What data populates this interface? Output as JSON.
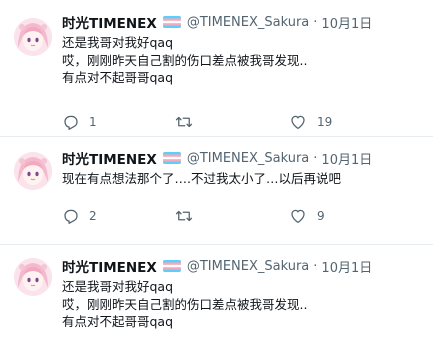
{
  "tweets": [
    {
      "display_name": "时光TIMENEX",
      "handle": "@TIMENEX_Sakura",
      "separator": "·",
      "date": "10月1日",
      "lines": [
        "还是我哥对我好qaq",
        "哎，刚刚昨天自己割的伤口差点被我哥发现..",
        "有点对不起哥哥qaq"
      ],
      "reply_count": "1",
      "retweet_count": "",
      "like_count": "19"
    },
    {
      "display_name": "时光TIMENEX",
      "handle": "@TIMENEX_Sakura",
      "separator": "·",
      "date": "10月1日",
      "lines": [
        "现在有点想法那个了….不过我太小了…以后再说吧"
      ],
      "reply_count": "2",
      "retweet_count": "",
      "like_count": "9"
    },
    {
      "display_name": "时光TIMENEX",
      "handle": "@TIMENEX_Sakura",
      "separator": "·",
      "date": "10月1日",
      "lines": [
        "还是我哥对我好qaq",
        "哎，刚刚昨天自己割的伤口差点被我哥发现..",
        "有点对不起哥哥qaq"
      ]
    }
  ],
  "icons": {
    "reply": "reply-icon",
    "retweet": "retweet-icon",
    "like": "heart-icon",
    "flag": "trans-flag-emoji"
  },
  "colors": {
    "text": "#0f1419",
    "secondary": "#536471",
    "divider": "#e6ecf0",
    "flag_blue": "#5bcefa",
    "flag_pink": "#f5a9b8"
  }
}
